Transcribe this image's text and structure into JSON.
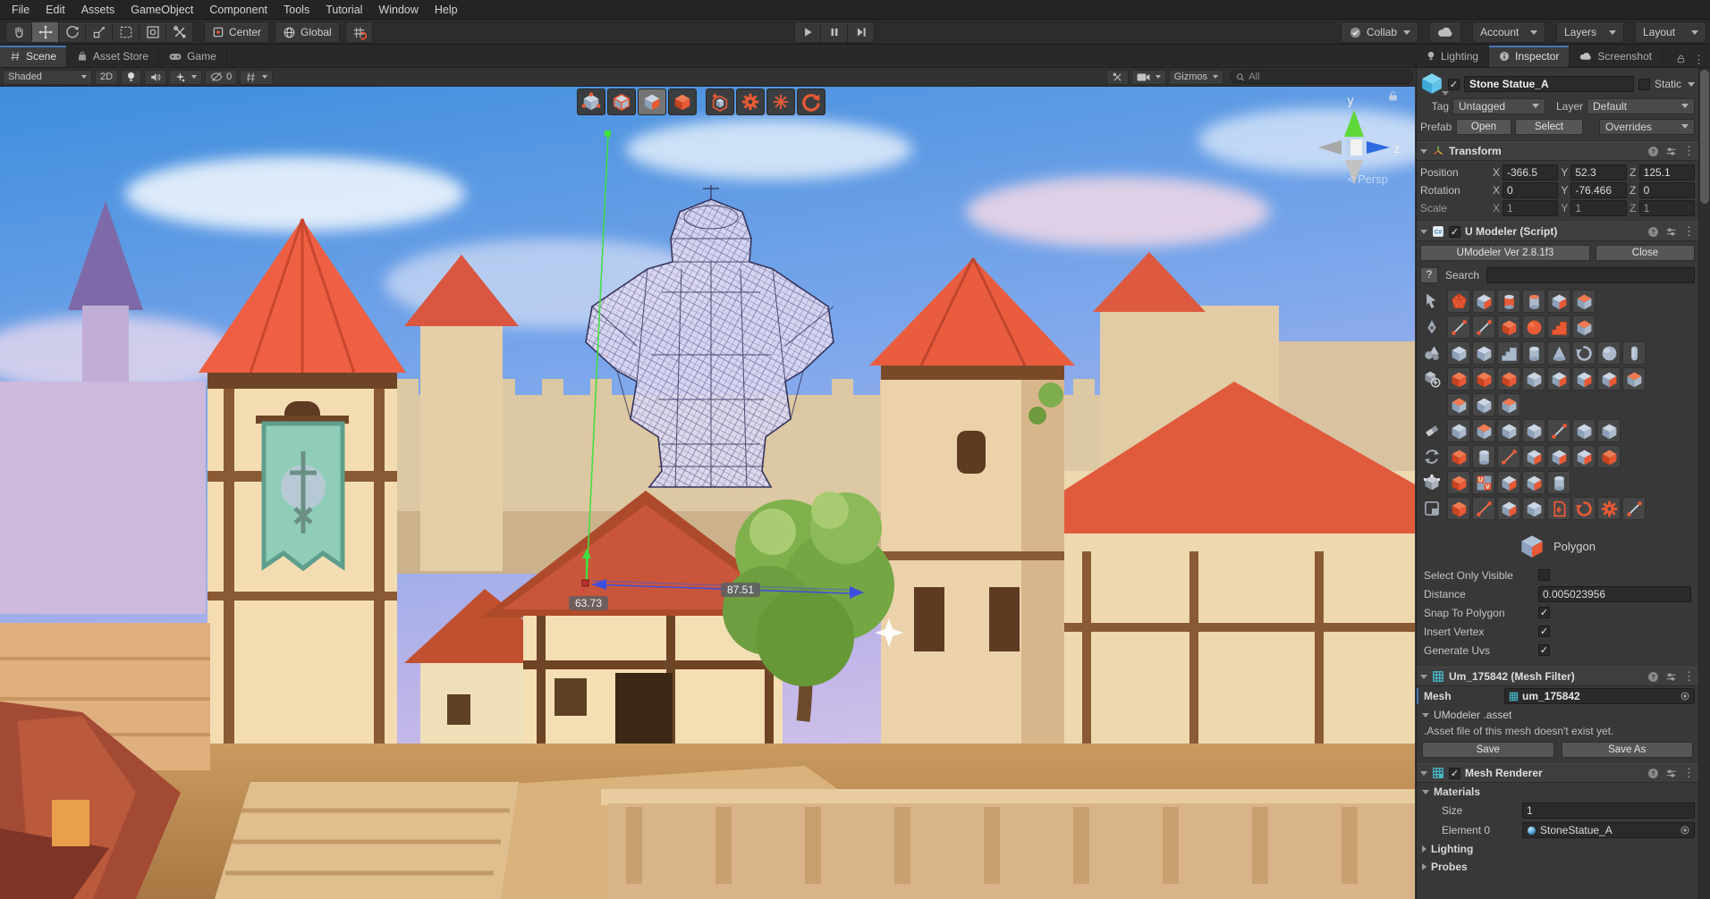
{
  "accent_colors": {
    "selection_blue": "#4673b8",
    "umodeler_orange": "#e8542f",
    "axis_green": "#5fd83a",
    "axis_blue": "#2f6be0",
    "tool_grey": "#abbacb"
  },
  "menu_bar": {
    "items": [
      "File",
      "Edit",
      "Assets",
      "GameObject",
      "Component",
      "Tools",
      "Tutorial",
      "Window",
      "Help"
    ]
  },
  "toolbar": {
    "pivot_button": "Center",
    "space_button": "Global",
    "collab_button": "Collab",
    "account_button": "Account",
    "layers_button": "Layers",
    "layout_button": "Layout"
  },
  "scene_tabs": {
    "scene": "Scene",
    "asset_store": "Asset Store",
    "game": "Game"
  },
  "scene_toolbar": {
    "shading_mode": "Shaded",
    "mode_2d": "2D",
    "hidden_count": "0",
    "gizmos_button": "Gizmos",
    "search_placeholder": "All"
  },
  "scene_view": {
    "mode_buttons": [
      {
        "name": "vertex-mode-button"
      },
      {
        "name": "edge-mode-button"
      },
      {
        "name": "face-mode-button",
        "active": true
      },
      {
        "name": "object-mode-button"
      },
      {
        "name": "add-shape-button"
      },
      {
        "name": "umodeler-settings-button"
      },
      {
        "name": "pivot-snap-button"
      },
      {
        "name": "reset-rotate-button"
      }
    ],
    "gizmo": {
      "axis_y": "y",
      "axis_z": "z",
      "persp_label": "< Persp"
    },
    "measurements": {
      "left": "63.73",
      "right": "87.51"
    }
  },
  "inspector": {
    "tabs": {
      "lighting": "Lighting",
      "inspector": "Inspector",
      "screenshot": "Screenshot"
    },
    "header": {
      "name": "Stone Statue_A",
      "static_label": "Static",
      "tag_label": "Tag",
      "tag_value": "Untagged",
      "layer_label": "Layer",
      "layer_value": "Default",
      "prefab_label": "Prefab",
      "open_button": "Open",
      "select_button": "Select",
      "overrides_button": "Overrides"
    },
    "transform": {
      "title": "Transform",
      "axis": [
        "X",
        "Y",
        "Z"
      ],
      "rows": [
        {
          "label": "Position",
          "values": [
            "-366.5",
            "52.3",
            "125.1"
          ]
        },
        {
          "label": "Rotation",
          "values": [
            "0",
            "-76.466",
            "0"
          ]
        },
        {
          "label": "Scale",
          "values": [
            "1",
            "1",
            "1"
          ]
        }
      ]
    },
    "umodeler": {
      "title": "U Modeler (Script)",
      "version_button": "UModeler Ver 2.8.1f3",
      "close_button": "Close",
      "help_button": "?",
      "search_label": "Search",
      "current_tool": "Polygon",
      "tool_rows": [
        {
          "category": "select-tools-icon",
          "tools": [
            {
              "name": "polyhedron-select-tool",
              "tint": "orange",
              "shape": "poly"
            },
            {
              "name": "move-element-tool",
              "tint": "mixed"
            },
            {
              "name": "gap-cylinder-tool",
              "tint": "mixed",
              "shape": "cylinder"
            },
            {
              "name": "merge-cylinder-tool",
              "tint": "mixed2",
              "shape": "cylinder"
            },
            {
              "name": "swirl-cube-tool",
              "tint": "mixed"
            },
            {
              "name": "swap-parts-tool",
              "tint": "mixed2"
            }
          ]
        },
        {
          "category": "draw-tools-icon",
          "tools": [
            {
              "name": "line-draw-tool",
              "tint": "mixed",
              "shape": "line"
            },
            {
              "name": "arc-draw-tool",
              "tint": "mixed",
              "shape": "line"
            },
            {
              "name": "rect-draw-tool",
              "tint": "orange"
            },
            {
              "name": "disc-draw-tool",
              "tint": "orange",
              "shape": "sphere"
            },
            {
              "name": "stair-draw-tool",
              "tint": "orange",
              "shape": "stairs"
            },
            {
              "name": "band-draw-tool",
              "tint": "mixed2"
            }
          ]
        },
        {
          "category": "primitive-tools-icon",
          "tools": [
            {
              "name": "cube-primitive",
              "tint": "grey"
            },
            {
              "name": "rounded-cube-primitive",
              "tint": "grey"
            },
            {
              "name": "stairs-primitive",
              "tint": "grey",
              "shape": "stairs"
            },
            {
              "name": "cylinder-primitive",
              "tint": "grey",
              "shape": "cylinder"
            },
            {
              "name": "cone-primitive",
              "tint": "grey",
              "shape": "cone"
            },
            {
              "name": "spiral-primitive",
              "tint": "grey",
              "shape": "spiral"
            },
            {
              "name": "sphere-primitive",
              "tint": "grey",
              "shape": "sphere"
            },
            {
              "name": "capsule-primitive",
              "tint": "grey",
              "shape": "capsule"
            }
          ]
        },
        {
          "category": "modify-tools-icon",
          "tools": [
            {
              "name": "push-face-tool",
              "tint": "orange"
            },
            {
              "name": "pull-face-tool",
              "tint": "orange"
            },
            {
              "name": "expand-face-tool",
              "tint": "orange"
            },
            {
              "name": "crease-tool",
              "tint": "grey"
            },
            {
              "name": "inset-tool",
              "tint": "mixed"
            },
            {
              "name": "extrude-tool",
              "tint": "mixed"
            },
            {
              "name": "multi-extrude-tool",
              "tint": "mixed"
            },
            {
              "name": "arch-tool",
              "tint": "mixed2"
            }
          ]
        },
        {
          "category": "",
          "tools": [
            {
              "name": "open-face-tool",
              "tint": "mixed2"
            },
            {
              "name": "array-tool",
              "tint": "grey"
            },
            {
              "name": "mirror-tool",
              "tint": "mixed2"
            }
          ]
        },
        {
          "category": "erase-tools-icon",
          "tools": [
            {
              "name": "flatten-tool",
              "tint": "grey"
            },
            {
              "name": "smooth-tool",
              "tint": "mixed2"
            },
            {
              "name": "bevel-tool",
              "tint": "grey"
            },
            {
              "name": "slice-tool",
              "tint": "grey"
            },
            {
              "name": "vertex-merge-tool",
              "tint": "mixed",
              "shape": "line"
            },
            {
              "name": "ramp-tool",
              "tint": "grey"
            },
            {
              "name": "hole-tool",
              "tint": "grey"
            }
          ]
        },
        {
          "category": "transform-tools-icon",
          "tools": [
            {
              "name": "material-fill-tool",
              "tint": "orange"
            },
            {
              "name": "cylinder-edit-tool",
              "tint": "grey",
              "shape": "cylinder"
            },
            {
              "name": "vertex-path-tool",
              "tint": "orange",
              "shape": "line"
            },
            {
              "name": "align-tool",
              "tint": "mixed"
            },
            {
              "name": "gizmo-move-tool",
              "tint": "mixed"
            },
            {
              "name": "plane-axis-tool",
              "tint": "mixed"
            },
            {
              "name": "bend-tool",
              "tint": "orange"
            }
          ]
        },
        {
          "category": "uv-tools-icon",
          "tools": [
            {
              "name": "cut-uv-tool",
              "tint": "orange"
            },
            {
              "name": "uv-editor-tool",
              "tint": "mixed",
              "shape": "uv"
            },
            {
              "name": "project-uv-tool",
              "tint": "mixed"
            },
            {
              "name": "box-uv-tool",
              "tint": "mixed"
            },
            {
              "name": "cylinder-uv-tool",
              "tint": "grey",
              "shape": "cylinder"
            }
          ]
        },
        {
          "category": "misc-tools-icon",
          "tools": [
            {
              "name": "add-shape-tool",
              "tint": "orange"
            },
            {
              "name": "pivot-edit-tool",
              "tint": "orange",
              "shape": "line"
            },
            {
              "name": "normal-edit-tool",
              "tint": "mixed"
            },
            {
              "name": "group-tool",
              "tint": "grey"
            },
            {
              "name": "export-tool",
              "tint": "orange",
              "shape": "doc"
            },
            {
              "name": "reset-transform-tool",
              "tint": "orange",
              "shape": "spiral"
            },
            {
              "name": "umodeler-settings-tool",
              "tint": "orange",
              "shape": "gear"
            },
            {
              "name": "diagnose-tool",
              "tint": "mixed",
              "shape": "line"
            }
          ]
        }
      ],
      "options": [
        {
          "label": "Select Only Visible",
          "type": "checkbox",
          "checked": false
        },
        {
          "label": "Distance",
          "type": "field",
          "value": "0.005023956"
        },
        {
          "label": "Snap To Polygon",
          "type": "checkbox",
          "checked": true
        },
        {
          "label": "Insert Vertex",
          "type": "checkbox",
          "checked": true
        },
        {
          "label": "Generate Uvs",
          "type": "checkbox",
          "checked": true
        }
      ]
    },
    "mesh_filter": {
      "title": "Um_175842 (Mesh Filter)",
      "mesh_label": "Mesh",
      "mesh_value": "um_175842",
      "asset_section": "UModeler .asset",
      "asset_message": ".Asset file of this mesh doesn't exist yet.",
      "save_button": "Save",
      "save_as_button": "Save As"
    },
    "mesh_renderer": {
      "title": "Mesh Renderer",
      "materials_label": "Materials",
      "size_label": "Size",
      "size_value": "1",
      "element_label": "Element 0",
      "element_value": "StoneStatue_A",
      "lighting_label": "Lighting",
      "probes_label": "Probes"
    }
  }
}
